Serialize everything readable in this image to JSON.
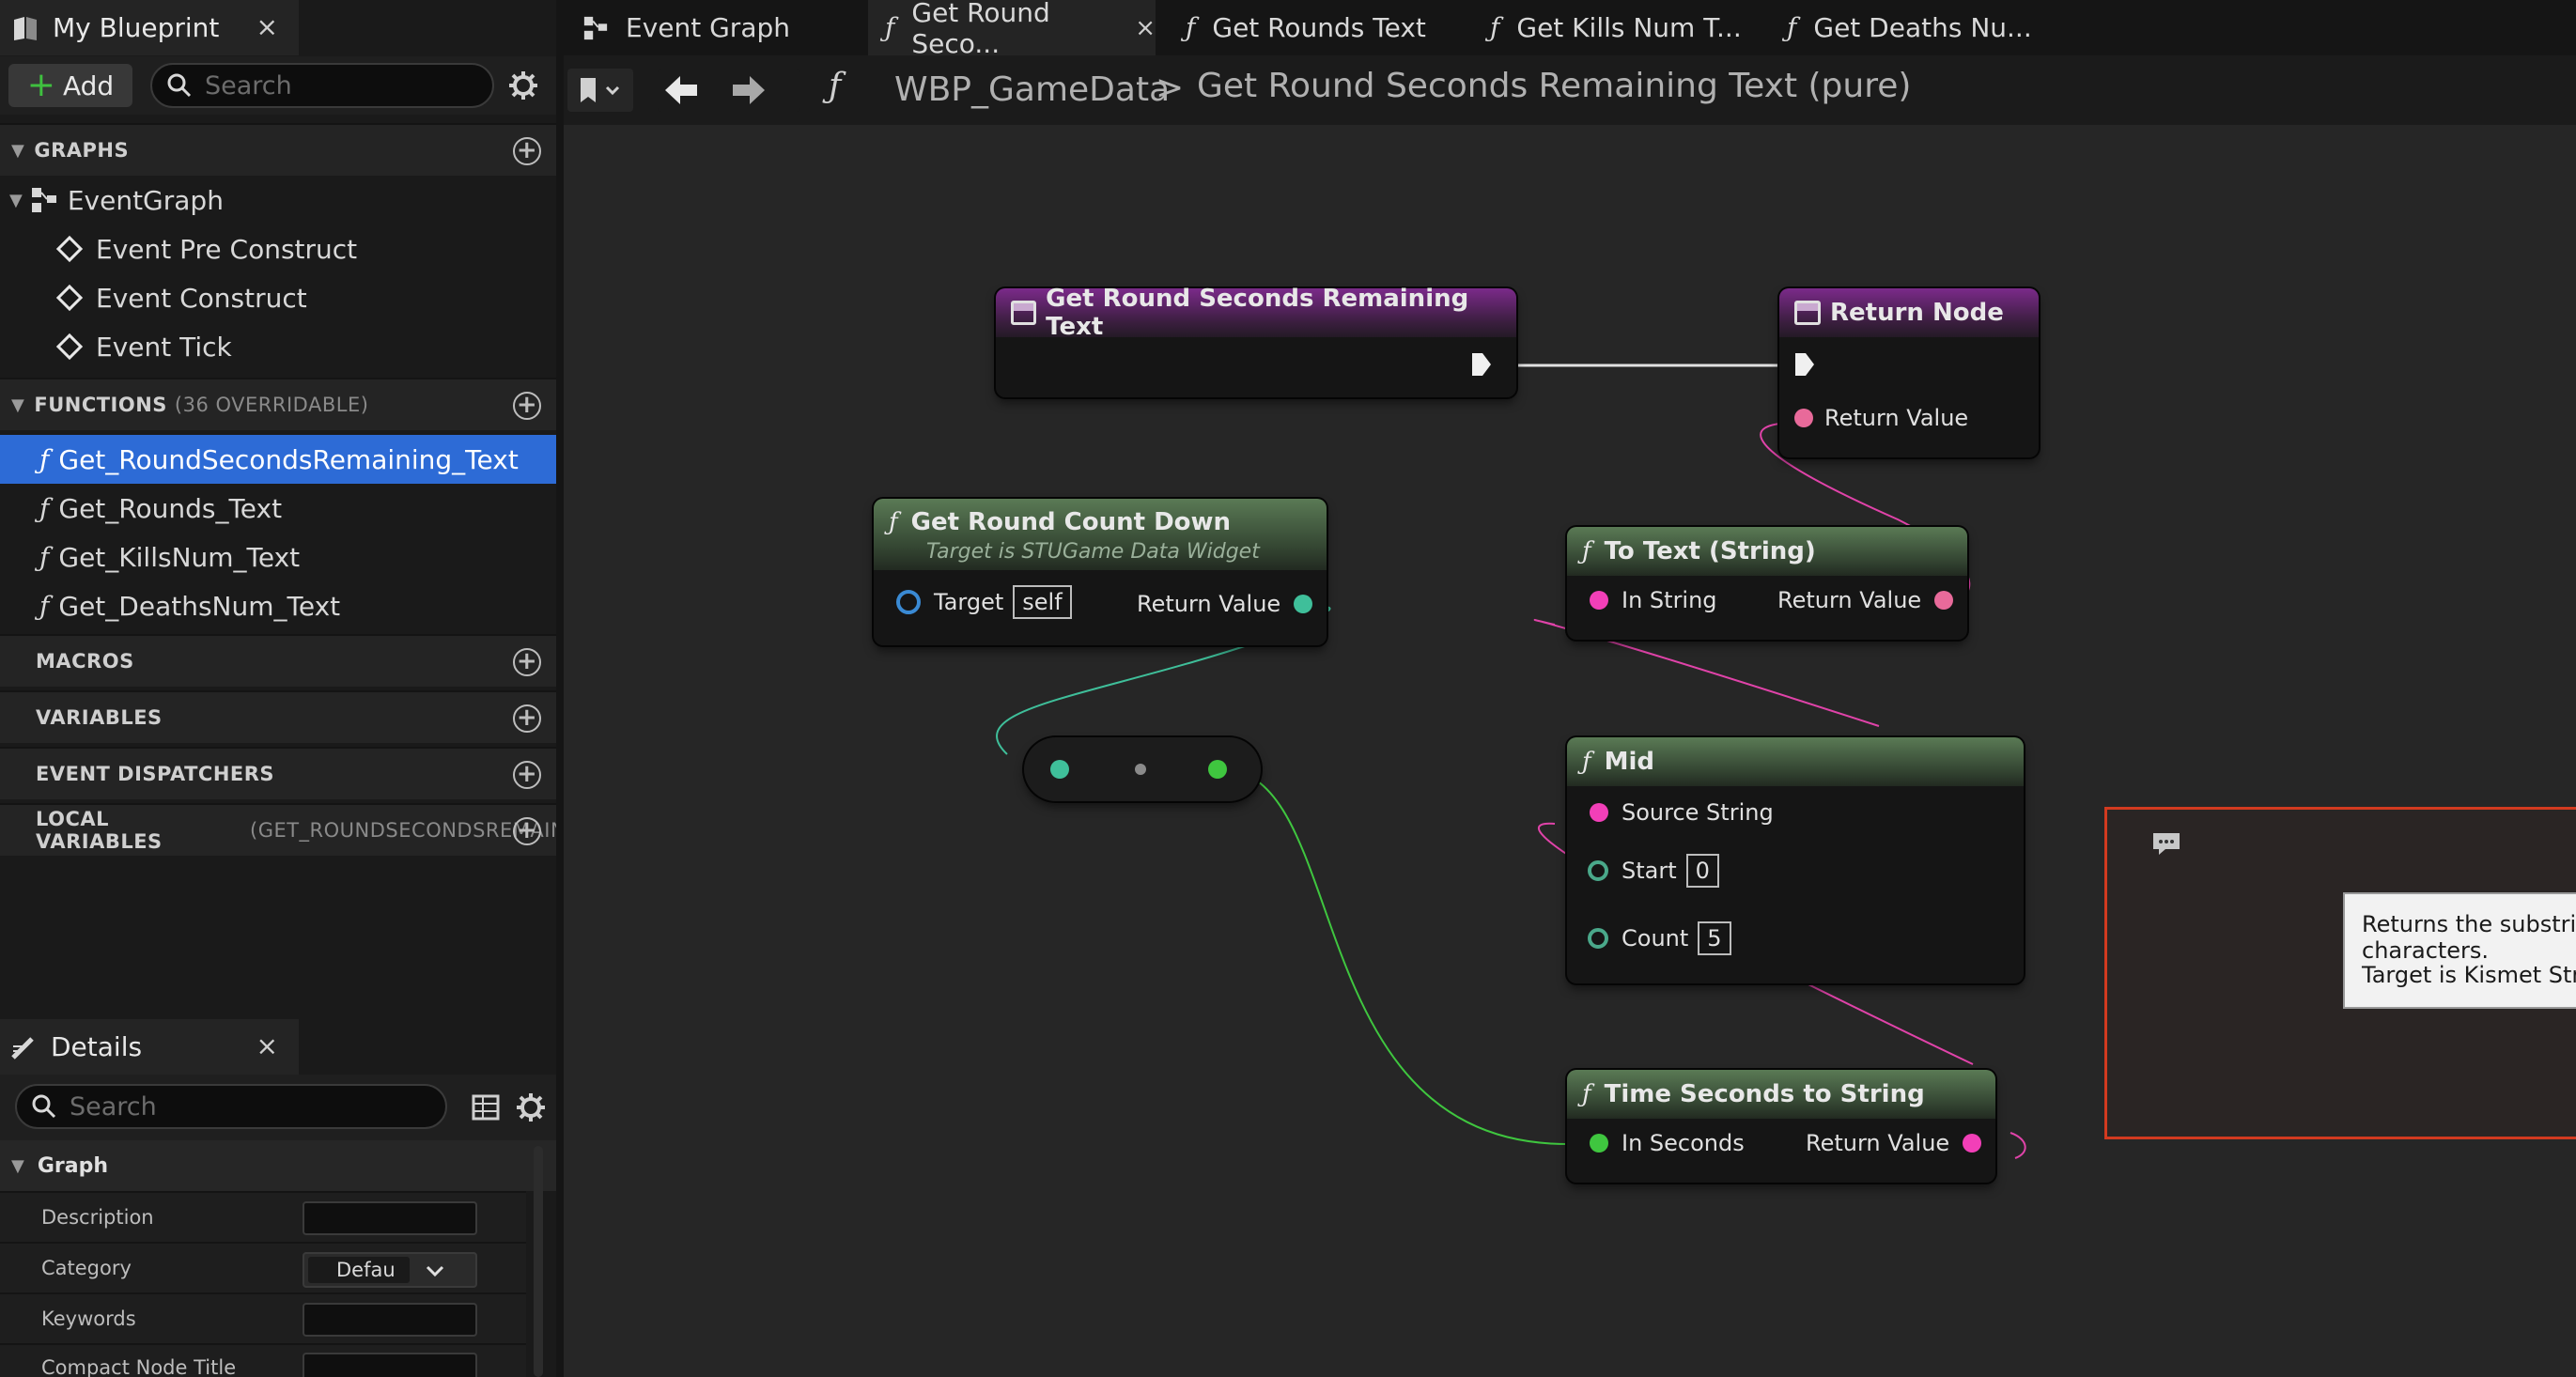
{
  "blueprint_panel": {
    "tab_title": "My Blueprint",
    "add_label": "Add",
    "search_placeholder": "Search",
    "sections": {
      "graphs": "GRAPHS",
      "functions": "FUNCTIONS",
      "functions_note": "(36 OVERRIDABLE)",
      "macros": "MACROS",
      "variables": "VARIABLES",
      "event_dispatchers": "EVENT DISPATCHERS",
      "local_variables": "LOCAL VARIABLES",
      "local_variables_note": "(GET_ROUNDSECONDSREMAININ"
    },
    "graph_items": [
      "EventGraph",
      "Event Pre Construct",
      "Event Construct",
      "Event Tick"
    ],
    "function_items": [
      "Get_RoundSecondsRemaining_Text",
      "Get_Rounds_Text",
      "Get_KillsNum_Text",
      "Get_DeathsNum_Text"
    ],
    "selected_function": "Get_RoundSecondsRemaining_Text"
  },
  "details_panel": {
    "tab_title": "Details",
    "search_placeholder": "Search",
    "section": "Graph",
    "rows": {
      "description": "Description",
      "category": "Category",
      "category_value": "Defau",
      "keywords": "Keywords",
      "compact_title": "Compact Node Title"
    }
  },
  "doc_tabs": [
    "Event Graph",
    "Get Round Seco...",
    "Get Rounds Text",
    "Get Kills Num T...",
    "Get Deaths Nu..."
  ],
  "active_tab": "Get Round Seco...",
  "breadcrumb": {
    "root": "WBP_GameData",
    "separator": ">",
    "current": "Get Round Seconds Remaining Text (pure)"
  },
  "nodes": {
    "entry": {
      "title": "Get Round Seconds Remaining Text"
    },
    "return": {
      "title": "Return Node",
      "pin": "Return Value"
    },
    "countdown": {
      "title": "Get Round Count Down",
      "subtitle": "Target is STUGame Data Widget",
      "target_label": "Target",
      "target_value": "self",
      "return_label": "Return Value"
    },
    "to_text": {
      "title": "To Text (String)",
      "in_label": "In String",
      "out_label": "Return Value"
    },
    "mid": {
      "title": "Mid",
      "source_label": "Source String",
      "start_label": "Start",
      "start_value": "0",
      "count_label": "Count",
      "count_value": "5"
    },
    "time_to_string": {
      "title": "Time Seconds to String",
      "in_label": "In Seconds",
      "out_label": "Return Value"
    }
  },
  "tooltip": {
    "line1": "Returns the substring from Start position for Count characters.",
    "line2": "Target is Kismet String Library"
  },
  "colors": {
    "selection": "#2d6bd6",
    "pure_header": "#5a7a55",
    "event_header": "#7b2a8a",
    "string_pin": "#f23fb8",
    "float_pin": "#3fc63f",
    "int_pin": "#4aa88a",
    "comment_border": "#d23a1f"
  }
}
